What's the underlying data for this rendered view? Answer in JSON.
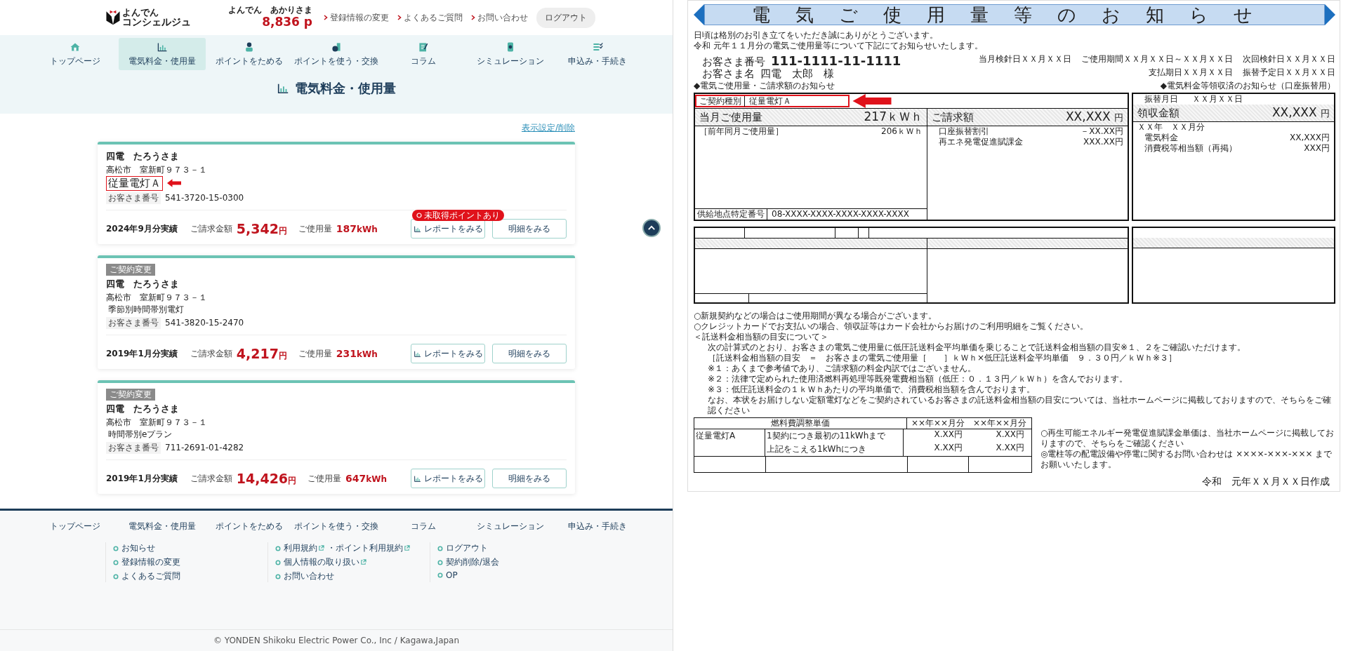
{
  "header": {
    "logo_line1": "よんでん",
    "logo_line2": "コンシェルジュ",
    "user_name": "よんでん　あかりさま",
    "points": "8,836 p",
    "links": [
      "登録情報の変更",
      "よくあるご質問",
      "お問い合わせ"
    ],
    "logout": "ログアウト"
  },
  "nav": [
    {
      "label": "トップページ",
      "selected": false
    },
    {
      "label": "電気料金・使用量",
      "selected": true
    },
    {
      "label": "ポイントをためる",
      "selected": false
    },
    {
      "label": "ポイントを使う・交換",
      "selected": false
    },
    {
      "label": "コラム",
      "selected": false
    },
    {
      "label": "シミュレーション",
      "selected": false
    },
    {
      "label": "申込み・手続き",
      "selected": false
    }
  ],
  "page_title": "電気料金・使用量",
  "display_settings_link": "表示設定/削除",
  "contracts": [
    {
      "name": "四電　たろうさま",
      "address": "高松市　室新町９７３－１",
      "plan": "従量電灯Ａ",
      "highlighted": true,
      "customer_no_label": "お客さま番号",
      "customer_no": "541-3720-15-0300",
      "period": "2024年9月分実績",
      "amount_label": "ご請求金額",
      "amount": "5,342",
      "amount_unit": "円",
      "usage_label": "ご使用量",
      "usage": "187",
      "usage_unit": "kWh",
      "report_badge": "未取得ポイントあり",
      "report_button": "レポートをみる",
      "detail_button": "明細をみる"
    },
    {
      "badge": "ご契約変更",
      "name": "四電　たろうさま",
      "address": "高松市　室新町９７３－１",
      "plan": "季節別時間帯別電灯",
      "highlighted": false,
      "customer_no_label": "お客さま番号",
      "customer_no": "541-3820-15-2470",
      "period": "2019年1月分実績",
      "amount_label": "ご請求金額",
      "amount": "4,217",
      "amount_unit": "円",
      "usage_label": "ご使用量",
      "usage": "231",
      "usage_unit": "kWh",
      "report_button": "レポートをみる",
      "detail_button": "明細をみる"
    },
    {
      "badge": "ご契約変更",
      "name": "四電　たろうさま",
      "address": "高松市　室新町９７３－１",
      "plan": "時間帯別eプラン",
      "highlighted": false,
      "customer_no_label": "お客さま番号",
      "customer_no": "711-2691-01-4282",
      "period": "2019年1月分実績",
      "amount_label": "ご請求金額",
      "amount": "14,426",
      "amount_unit": "円",
      "usage_label": "ご使用量",
      "usage": "647",
      "usage_unit": "kWh",
      "report_button": "レポートをみる",
      "detail_button": "明細をみる"
    }
  ],
  "footer": {
    "nav": [
      "トップページ",
      "電気料金・使用量",
      "ポイントをためる",
      "ポイントを使う・交換",
      "コラム",
      "シミュレーション",
      "申込み・手続き"
    ],
    "columns": [
      [
        {
          "parts": [
            {
              "text": "お知らせ",
              "external": false
            }
          ]
        },
        {
          "parts": [
            {
              "text": "登録情報の変更",
              "external": false
            }
          ]
        },
        {
          "parts": [
            {
              "text": "よくあるご質問",
              "external": false
            }
          ]
        }
      ],
      [
        {
          "parts": [
            {
              "text": "利用規約",
              "external": true
            },
            {
              "text": "・ポイント利用規約",
              "external": true
            }
          ]
        },
        {
          "parts": [
            {
              "text": "個人情報の取り扱い",
              "external": true
            }
          ]
        },
        {
          "parts": [
            {
              "text": "お問い合わせ",
              "external": false
            }
          ]
        }
      ],
      [
        {
          "parts": [
            {
              "text": "ログアウト",
              "external": false
            }
          ]
        },
        {
          "parts": [
            {
              "text": "契約削除/退会",
              "external": false
            }
          ]
        },
        {
          "parts": [
            {
              "text": "OP",
              "external": false
            }
          ]
        }
      ]
    ],
    "copyright": "© YONDEN Shikoku Electric Power Co., Inc / Kagawa,Japan"
  },
  "notice": {
    "title": "電気ご使用量等のお知らせ",
    "greeting": [
      "日頃は格別のお引き立てをいただき誠にありがとうございます。",
      "令和 元年１１月分の電気ご使用量等について下記にてお知らせいたします。"
    ],
    "customer_number_label": "お客さま番号",
    "customer_number": "111-1111-11-1111",
    "customer_name_label": "お客さま名",
    "customer_name": "四電　太郎　様",
    "dates": [
      "当月検針日ＸＸ月ＸＸ日",
      "ご使用期間ＸＸ月ＸＸ日～ＸＸ月ＸＸ日",
      "次回検針日ＸＸ月ＸＸ日",
      "支払期日ＸＸ月ＸＸ日",
      "振替予定日ＸＸ月ＸＸ日"
    ],
    "usage_section_title": "◆電気ご使用量・ご請求額のお知らせ",
    "receipt_section_title": "◆電気料金等領収済のお知らせ（口座振替用）",
    "contract_type_label": "ご契約種別",
    "contract_type": "従量電灯Ａ",
    "contract_highlighted": true,
    "usage_label": "当月ご使用量",
    "usage": "217ｋＷｈ",
    "prev_usage_label": "［前年同月ご使用量］",
    "prev_usage": "206ｋＷｈ",
    "supply_point_label": "供給地点特定番号",
    "supply_point": "08-XXXX-XXXX-XXXX-XXXX-XXXX",
    "billing_label": "ご請求額",
    "billing": "XX,XXX",
    "billing_unit": "円",
    "billing_items": [
      {
        "label": "口座振替割引",
        "value": "－XX.XX円"
      },
      {
        "label": "再エネ発電促進賦課金",
        "value": "XXX.XX円"
      }
    ],
    "transfer_label": "振替月日",
    "transfer_date": "ＸＸ月ＸＸ日",
    "receipt_label": "領収金額",
    "receipt": "XX,XXX",
    "receipt_unit": "円",
    "receipt_period": "ＸＸ年　ＸＸ月分",
    "receipt_items": [
      {
        "label": "電気料金",
        "value": "XX,XXX円"
      },
      {
        "label": "消費税等相当額（再掲）",
        "value": "XXX円"
      }
    ],
    "notes": [
      {
        "text": "○新規契約などの場合はご使用期間が異なる場合がございます。",
        "indent": false
      },
      {
        "text": "○クレジットカードでお支払いの場合、領収証等はカード会社からお届けのご利用明細をご覧ください。",
        "indent": false
      },
      {
        "text": "＜託送料金相当額の目安について＞",
        "indent": false
      },
      {
        "text": "次の計算式のとおり、お客さまの電気ご使用量に低圧託送料金平均単価を乗じることで託送料金相当額の目安※１、２をご確認いただけます。",
        "indent": true
      },
      {
        "text": "［託送料金相当額の目安　＝　お客さまの電気ご使用量［　　］ｋＷｈ×低圧託送料金平均単価　９．３０円／ｋＷｈ※３］",
        "indent": true
      },
      {
        "text": "※１：あくまで参考値であり、ご請求額の料金内訳ではございません。",
        "indent": true
      },
      {
        "text": "※２：法律で定められた使用済燃料再処理等既発電費相当額（低圧：０．１３円／ｋＷｈ）を含んでおります。",
        "indent": true
      },
      {
        "text": "※３：低圧託送料金の１ｋＷｈあたりの平均単価で、消費税相当額を含んでおります。",
        "indent": true
      },
      {
        "text": "なお、本状をお届けしない定額電灯などをご契約されているお客さまの託送料金相当額の目安については、当社ホームページに掲載しておりますので、そちらをご確認ください",
        "indent": true
      }
    ],
    "fuel_table": {
      "title": "燃料費調整単価",
      "month_headers": [
        "××年××月分",
        "××年××月分"
      ],
      "plan": "従量電灯A",
      "rows": [
        {
          "label": "1契約につき最初の11kWhまで",
          "values": [
            "X.XX円",
            "X.XX円"
          ]
        },
        {
          "label": "上記をこえる1kWhにつき",
          "values": [
            "X.XX円",
            "X.XX円"
          ]
        }
      ]
    },
    "side_notes": [
      "○再生可能エネルギー発電促進賦課金単価は、当社ホームページに掲載しておりますので、そちらをご確認ください",
      "◎電柱等の配電設備や停電に関するお問い合わせは ××××-×××-××× までお願いいたします。"
    ],
    "created": "令和　元年ＸＸ月ＸＸ日作成"
  }
}
